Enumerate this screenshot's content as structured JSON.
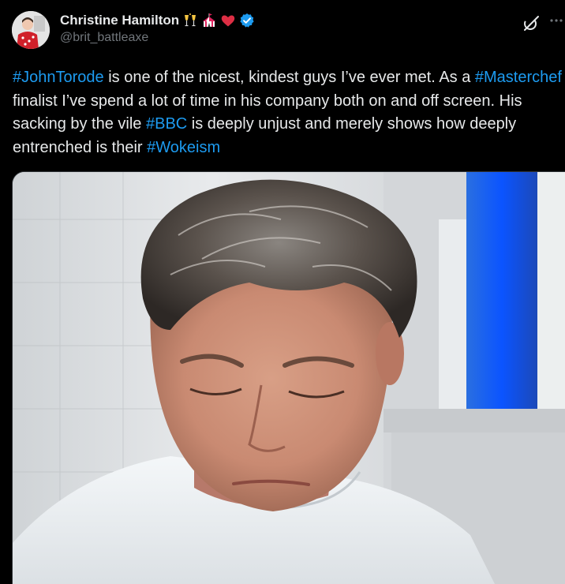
{
  "author": {
    "display_name": "Christine Hamilton",
    "handle": "@brit_battleaxe",
    "verified": true,
    "name_emojis": [
      "champagne-icon",
      "circus-tent-icon",
      "red-heart-icon"
    ]
  },
  "header_actions": {
    "grok_icon": "grok-icon",
    "more_icon": "more-dots-icon"
  },
  "tweet": {
    "segments": [
      {
        "text": "#JohnTorode",
        "hashtag": true
      },
      {
        "text": " is one of the nicest, kindest guys I’ve ever met. As a ",
        "hashtag": false
      },
      {
        "text": "#Masterchef",
        "hashtag": true
      },
      {
        "text": " finalist I’ve spend a lot of time in his company both on and off screen. His sacking by the vile ",
        "hashtag": false
      },
      {
        "text": "#BBC",
        "hashtag": true
      },
      {
        "text": " is deeply unjust and merely shows how deeply entrenched is their ",
        "hashtag": false
      },
      {
        "text": "#Wokeism",
        "hashtag": true
      }
    ]
  },
  "colors": {
    "background": "#000000",
    "text": "#e7e9ea",
    "secondary": "#71767b",
    "link": "#1d9bf0",
    "verified": "#1d9bf0",
    "heart": "#f91880"
  }
}
